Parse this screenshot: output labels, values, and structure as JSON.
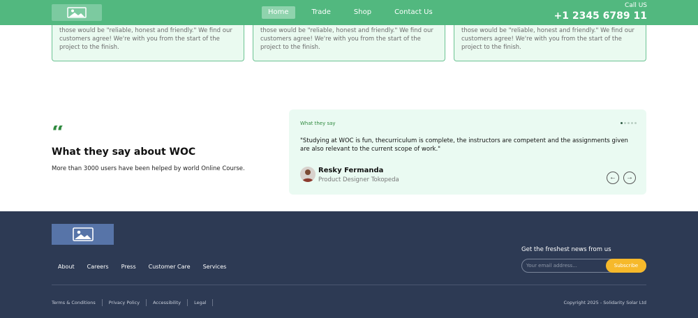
{
  "header": {
    "logo_icon": "image-icon",
    "nav": [
      "Home",
      "Trade",
      "Shop",
      "Contact Us"
    ],
    "active_nav": "Home",
    "call_label": "Call US",
    "call_number": "+1 2345 6789 11",
    "bg_color": "#52b87f"
  },
  "cards": [
    {
      "text": "those would be \"reliable, honest and friendly.\" We find our customers agree! We're with you from the start of the project to the finish."
    },
    {
      "text": "those would be \"reliable, honest and friendly.\" We find our customers agree! We're with you from the start of the project to the finish."
    },
    {
      "text": "those would be \"reliable, honest and friendly.\" We find our customers agree! We're with you from the start of the project to the finish."
    }
  ],
  "testimonials": {
    "quote_icon": "quote-icon",
    "title": "What they say about WOC",
    "subtitle": "More than 3000 users have been helped by world Online Course.",
    "label": "What they say",
    "dots_count": 5,
    "active_dot": 0,
    "quote": "\"Studying at WOC is fun, thecurriculum is complete, the instructors are competent and the assignments given are also relevant to the current scope of work.\"",
    "name": "Resky Fermanda",
    "role": "Product Designer Tokopeda",
    "prev_icon": "arrow-left-icon",
    "next_icon": "arrow-right-icon"
  },
  "footer": {
    "logo_icon": "image-icon",
    "links": [
      "About",
      "Careers",
      "Press",
      "Customer Care",
      "Services"
    ],
    "newsletter_label": "Get the freshest news from us",
    "email_placeholder": "Your email address...",
    "subscribe_label": "Subscribe",
    "legal_links": [
      "Terms & Conditions",
      "Privacy Policy",
      "Accessibility",
      "Legal"
    ],
    "copyright": "Copyright 2025 - Solidarity Solar Ltd",
    "bg_color": "#2d3a54",
    "accent_color": "#f6b92b"
  }
}
